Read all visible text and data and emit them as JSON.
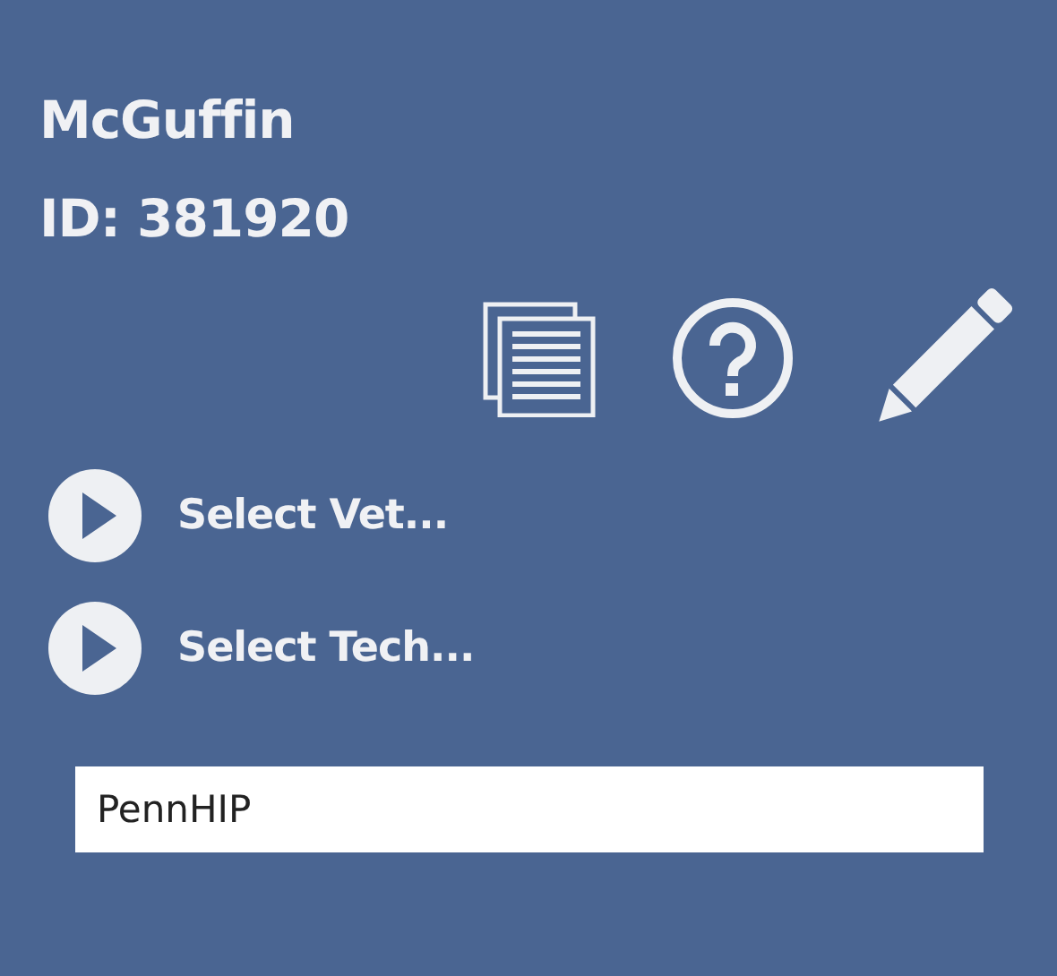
{
  "patient": {
    "name": "McGuffin",
    "id": "ID: 381920"
  },
  "selectors": [
    {
      "label": "Select Vet..."
    },
    {
      "label": "Select Tech..."
    }
  ],
  "field": {
    "value": "PennHIP"
  }
}
